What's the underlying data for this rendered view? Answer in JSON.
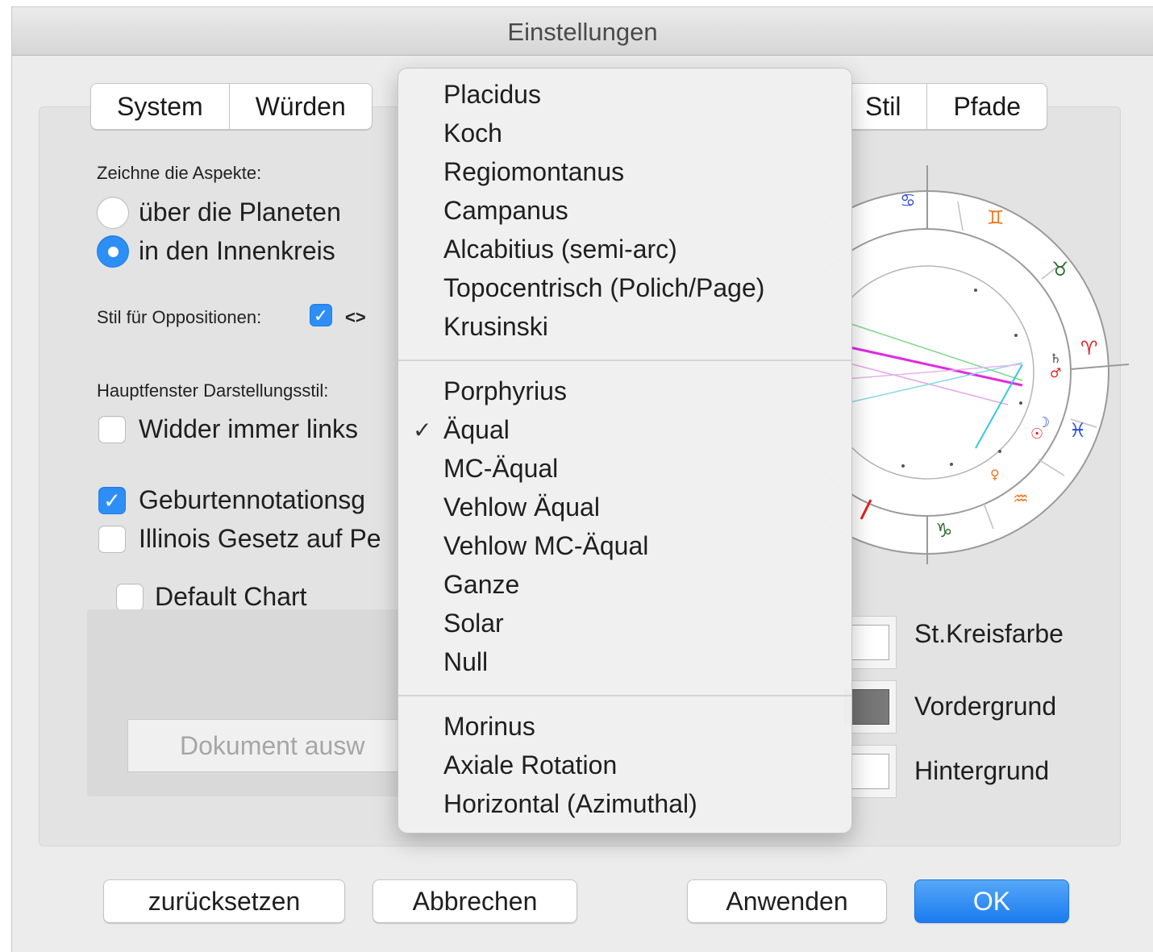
{
  "window": {
    "title": "Einstellungen"
  },
  "tabs": {
    "left": [
      "System",
      "Würden"
    ],
    "right": [
      "Stil",
      "Pfade"
    ]
  },
  "aspects": {
    "heading": "Zeichne die Aspekte:",
    "options": [
      "über die Planeten",
      "in den Innenkreis"
    ],
    "selected": 1
  },
  "oppositions": {
    "label": "Stil für Oppositionen:",
    "checked": true,
    "symbol": "<>"
  },
  "main_window_style": {
    "label": "Hauptfenster  Darstellungsstil:"
  },
  "checkboxes": {
    "aries_left": {
      "label": "Widder immer links",
      "checked": false
    },
    "birth_notation": {
      "label": "Geburtennotationsg",
      "checked": true
    },
    "illinois": {
      "label": "Illinois Gesetz auf Pe",
      "checked": false
    },
    "default_chart": {
      "label": "Default Chart",
      "checked": false
    }
  },
  "document_button": "Dokument ausw",
  "colors": {
    "circle": "St.Kreisfarbe",
    "foreground": "Vordergrund",
    "background": "Hintergrund"
  },
  "buttons": {
    "reset": "zurücksetzen",
    "cancel": "Abbrechen",
    "apply": "Anwenden",
    "ok": "OK"
  },
  "house_menu": {
    "group1": [
      "Placidus",
      "Koch",
      "Regiomontanus",
      "Campanus",
      "Alcabitius (semi-arc)",
      "Topocentrisch (Polich/Page)",
      "Krusinski"
    ],
    "group2": [
      "Porphyrius",
      "Äqual",
      "MC-Äqual",
      "Vehlow Äqual",
      "Vehlow MC-Äqual",
      "Ganze",
      "Solar",
      "Null"
    ],
    "group3": [
      "Morinus",
      "Axiale Rotation",
      "Horizontal (Azimuthal)"
    ],
    "selected": "Äqual",
    "check_mark": "✓"
  },
  "chart_glyphs": {
    "cancer": "♋",
    "gemini": "♊",
    "taurus": "♉",
    "aries": "♈",
    "pisces": "♓",
    "aquarius": "♒",
    "capricorn": "♑",
    "saturn": "♄",
    "mars": "♂",
    "moon": "☽",
    "sun": "☉",
    "venus": "♀"
  },
  "accent": "#2d8ff5"
}
